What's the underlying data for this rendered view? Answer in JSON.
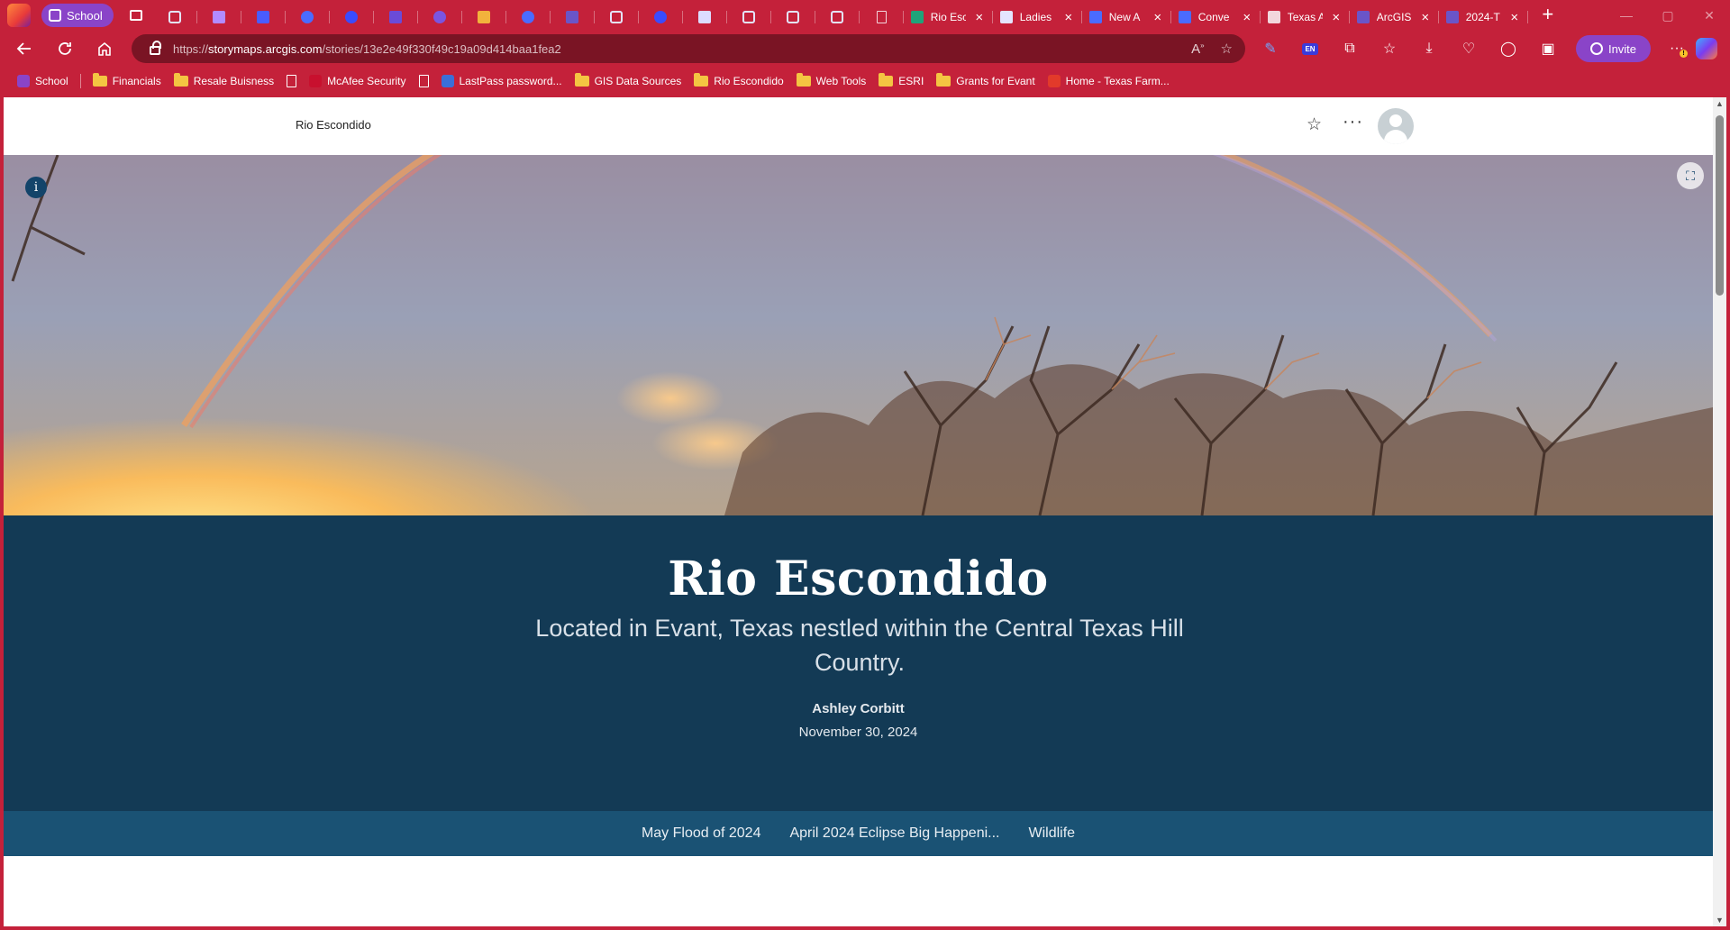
{
  "browser": {
    "workspace_label": "School",
    "tabs": [
      {
        "kind": "pinned",
        "icon": "tab-favicon",
        "color": "#e4e4ff",
        "fav": "kind-tp"
      },
      {
        "kind": "pinned",
        "icon": "tab-favicon",
        "color": "#b28bff",
        "fav": "kind-sq"
      },
      {
        "kind": "pinned",
        "icon": "tab-favicon",
        "color": "#4a5cff",
        "fav": "kind-sq"
      },
      {
        "kind": "pinned",
        "icon": "tab-favicon",
        "color": "#4a6bff",
        "fav": "kind-dot"
      },
      {
        "kind": "pinned",
        "icon": "tab-favicon",
        "color": "#3a4bff",
        "fav": "kind-dot"
      },
      {
        "kind": "pinned",
        "icon": "tab-favicon",
        "color": "#6a4bd8",
        "fav": "kind-sq"
      },
      {
        "kind": "pinned",
        "icon": "tab-favicon",
        "color": "#7a55e0",
        "fav": "kind-dot"
      },
      {
        "kind": "pinned",
        "icon": "tab-favicon",
        "color": "#f2b23c",
        "fav": "kind-sq"
      },
      {
        "kind": "pinned",
        "icon": "tab-favicon",
        "color": "#4a6bff",
        "fav": "kind-dot"
      },
      {
        "kind": "pinned",
        "icon": "tab-favicon",
        "color": "#6a55c8",
        "fav": "kind-sq"
      },
      {
        "kind": "pinned",
        "icon": "tab-favicon",
        "color": "#e4e4ff",
        "fav": "kind-tp"
      },
      {
        "kind": "pinned",
        "icon": "tab-favicon",
        "color": "#3a4bff",
        "fav": "kind-dot"
      },
      {
        "kind": "pinned",
        "icon": "tab-favicon",
        "color": "#dcdcff",
        "fav": "kind-sq"
      },
      {
        "kind": "pinned",
        "icon": "tab-favicon",
        "color": "#e4e4ff",
        "fav": "kind-tp"
      },
      {
        "kind": "pinned",
        "icon": "tab-favicon",
        "color": "#e4e4ff",
        "fav": "kind-tp"
      },
      {
        "kind": "pinned",
        "icon": "tab-favicon",
        "color": "#e4e4ff",
        "fav": "kind-tp"
      },
      {
        "kind": "pinned",
        "icon": "tab-favicon",
        "color": "#f2d6dc",
        "fav": "kind-doc"
      }
    ],
    "titled_tabs": [
      {
        "title": "Rio Esc",
        "color": "#1fa37a",
        "active": true
      },
      {
        "title": "Ladies",
        "color": "#e4e4ff",
        "active": false
      },
      {
        "title": "New A",
        "color": "#4a6bff",
        "active": false
      },
      {
        "title": "Conve",
        "color": "#4a6bff",
        "active": false
      },
      {
        "title": "Texas A",
        "color": "#f2d6dc",
        "active": false
      },
      {
        "title": "ArcGIS",
        "color": "#6a55c8",
        "active": false
      },
      {
        "title": "2024-T",
        "color": "#6a55c8",
        "active": false
      }
    ],
    "tab_close_glyph": "×",
    "new_tab_glyph": "+",
    "url_scheme": "https://",
    "url_host": "storymaps.arcgis.com",
    "url_path": "/stories/13e2e49f330f49c19a09d414baa1fea2",
    "invite_label": "Invite",
    "extension_en_label": "EN",
    "favorites": [
      {
        "label": "School",
        "type": "site",
        "color": "#8a44c8"
      },
      {
        "label": "Financials",
        "type": "folder"
      },
      {
        "label": "Resale Buisness",
        "type": "folder"
      },
      {
        "label": "",
        "type": "page"
      },
      {
        "label": "McAfee Security",
        "type": "site",
        "color": "#c8102e"
      },
      {
        "label": "",
        "type": "page"
      },
      {
        "label": "LastPass password...",
        "type": "site",
        "color": "#3a6fd8"
      },
      {
        "label": "GIS Data Sources",
        "type": "folder"
      },
      {
        "label": "Rio Escondido",
        "type": "folder"
      },
      {
        "label": "Web Tools",
        "type": "folder"
      },
      {
        "label": "ESRI",
        "type": "folder"
      },
      {
        "label": "Grants for Evant",
        "type": "folder"
      },
      {
        "label": "Home - Texas Farm...",
        "type": "site",
        "color": "#e23a2a"
      }
    ]
  },
  "story": {
    "header_title": "Rio Escondido",
    "title": "Rio Escondido",
    "subtitle": "Located in Evant, Texas nestled within the Central Texas Hill Country.",
    "author": "Ashley Corbitt",
    "date": "November 30, 2024",
    "info_glyph": "i",
    "nav_links": [
      "May Flood of 2024",
      "April 2024 Eclipse Big Happeni...",
      "Wildlife"
    ]
  }
}
